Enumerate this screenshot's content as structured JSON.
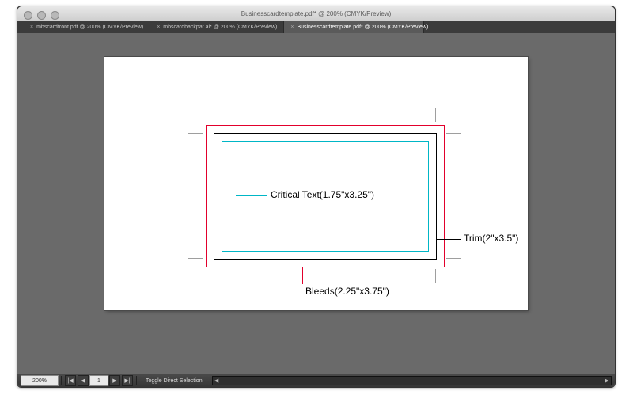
{
  "window": {
    "title": "Businesscardtemplate.pdf* @ 200% (CMYK/Preview)"
  },
  "tabs": [
    {
      "label": "mbscardfront.pdf @ 200% (CMYK/Preview)"
    },
    {
      "label": "mbscardbackpat.ai* @ 200% (CMYK/Preview)"
    },
    {
      "label": "Businesscardtemplate.pdf* @ 200% (CMYK/Preview)"
    }
  ],
  "statusbar": {
    "zoom": "200%",
    "page": "1",
    "toggle_label": "Toggle Direct Selection"
  },
  "callouts": {
    "critical": "Critical Text(1.75\"x3.25\")",
    "trim": "Trim(2\"x3.5\")",
    "bleeds": "Bleeds(2.25\"x3.75\")"
  },
  "icons": {
    "close": "×",
    "left": "◀",
    "right": "▶",
    "first": "|◀",
    "last": "▶|"
  }
}
